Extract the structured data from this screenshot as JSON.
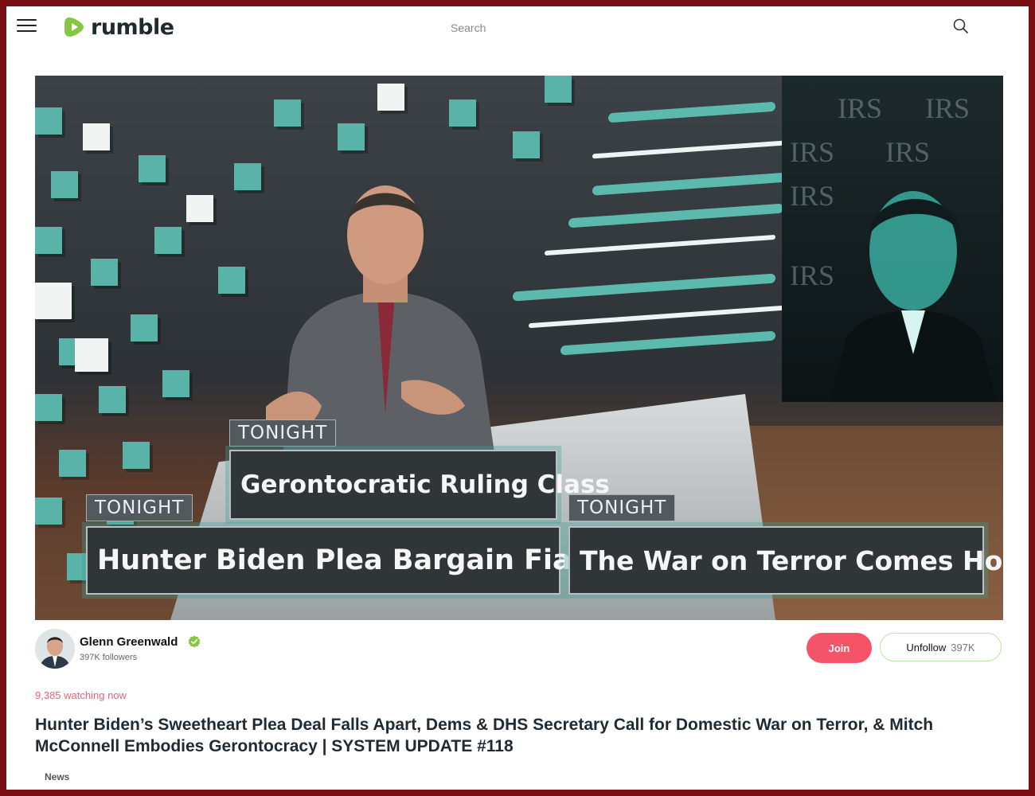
{
  "header": {
    "brand": "rumble",
    "search_placeholder": "Search"
  },
  "video": {
    "lower_thirds": [
      {
        "kicker": "TONIGHT",
        "headline": "Gerontocratic Ruling Class"
      },
      {
        "kicker": "TONIGHT",
        "headline": "Hunter Biden Plea Bargain Fiasco"
      },
      {
        "kicker": "TONIGHT",
        "headline": "The War on Terror Comes Home"
      }
    ],
    "background_text": [
      "IRS",
      "IRS",
      "IRS",
      "IRS",
      "IRS",
      "IRS"
    ]
  },
  "channel": {
    "name": "Glenn Greenwald",
    "followers": "397K followers",
    "join_label": "Join",
    "unfollow_label": "Unfollow",
    "unfollow_count": "397K"
  },
  "status": {
    "watching": "9,385 watching now"
  },
  "video_title": "Hunter Biden’s Sweetheart Plea Deal Falls Apart, Dems & DHS Secretary Call for Domestic War on Terror, & Mitch McConnell Embodies Gerontocracy | SYSTEM UPDATE #118",
  "category": "News",
  "colors": {
    "brand_green": "#85c742",
    "join_red": "#f45368",
    "watching_pink": "#f0607a",
    "frame_border": "#7a0f16"
  },
  "icons": {
    "menu": "hamburger-icon",
    "search": "search-icon",
    "verified": "verified-check-icon",
    "logo": "play-logo-icon"
  }
}
